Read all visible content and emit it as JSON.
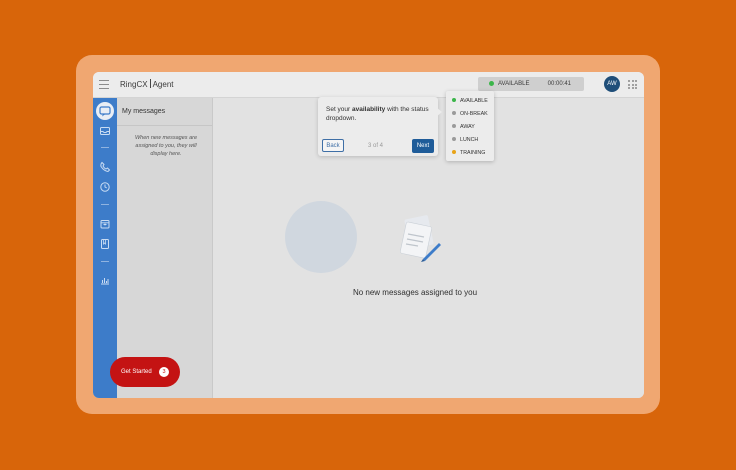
{
  "header": {
    "brand_left": "RingCX",
    "brand_right": "Agent",
    "status": "AVAILABLE",
    "timer": "00:00:41",
    "avatar_initials": "AW"
  },
  "sidebar": {
    "icons": [
      "messages-icon",
      "inbox-icon",
      "phone-icon",
      "history-icon",
      "calendar-icon",
      "notes-icon",
      "analytics-icon"
    ]
  },
  "panel": {
    "title": "My messages",
    "hint": "When new messages are assigned to you, they will display here."
  },
  "tooltip": {
    "text_before": "Set your ",
    "text_bold": "availability",
    "text_after": " with the status dropdown.",
    "back_label": "Back",
    "step": "3 of 4",
    "next_label": "Next"
  },
  "status_dropdown": {
    "options": [
      {
        "label": "AVAILABLE",
        "color": "#3bb54a"
      },
      {
        "label": "ON-BREAK",
        "color": "#9a9a9a"
      },
      {
        "label": "AWAY",
        "color": "#9a9a9a"
      },
      {
        "label": "LUNCH",
        "color": "#9a9a9a"
      },
      {
        "label": "TRAINING",
        "color": "#e8a317"
      }
    ]
  },
  "main": {
    "empty_message": "No new messages assigned to you"
  },
  "get_started": {
    "label": "Get Started",
    "count": "3"
  },
  "colors": {
    "accent": "#3d7cc9",
    "brand_button": "#1f5c99",
    "get_started": "#c41313",
    "background": "#d8650a"
  }
}
